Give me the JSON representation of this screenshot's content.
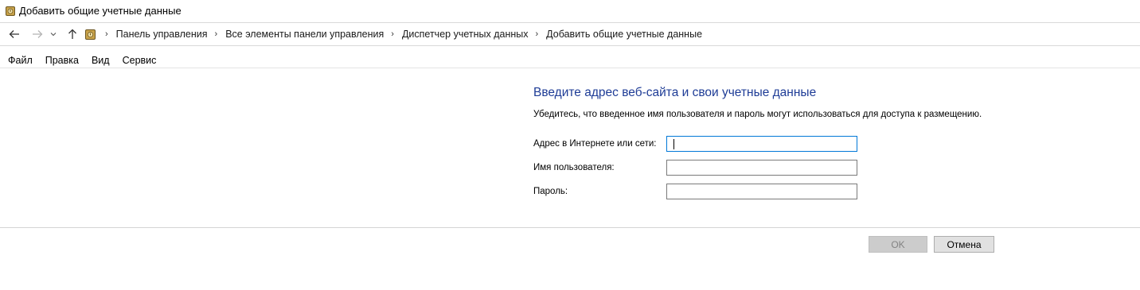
{
  "window": {
    "title": "Добавить общие учетные данные"
  },
  "nav": {
    "back_icon": "arrow-left-icon",
    "forward_icon": "arrow-right-icon",
    "recent_icon": "chevron-down-icon",
    "up_icon": "arrow-up-icon",
    "breadcrumb": [
      "Панель управления",
      "Все элементы панели управления",
      "Диспетчер учетных данных",
      "Добавить общие учетные данные"
    ]
  },
  "menu": {
    "items": [
      "Файл",
      "Правка",
      "Вид",
      "Сервис"
    ]
  },
  "form": {
    "heading": "Введите адрес веб-сайта и свои учетные данные",
    "description": "Убедитесь, что введенное имя пользователя и пароль могут использоваться для доступа к размещению.",
    "address_label": "Адрес в Интернете или сети:",
    "address_value": "",
    "username_label": "Имя пользователя:",
    "username_value": "",
    "password_label": "Пароль:",
    "password_value": ""
  },
  "buttons": {
    "ok_label": "OK",
    "cancel_label": "Отмена"
  },
  "colors": {
    "heading": "#1e3c96",
    "focus_border": "#0078d7",
    "disabled_button": "#cccccc"
  }
}
